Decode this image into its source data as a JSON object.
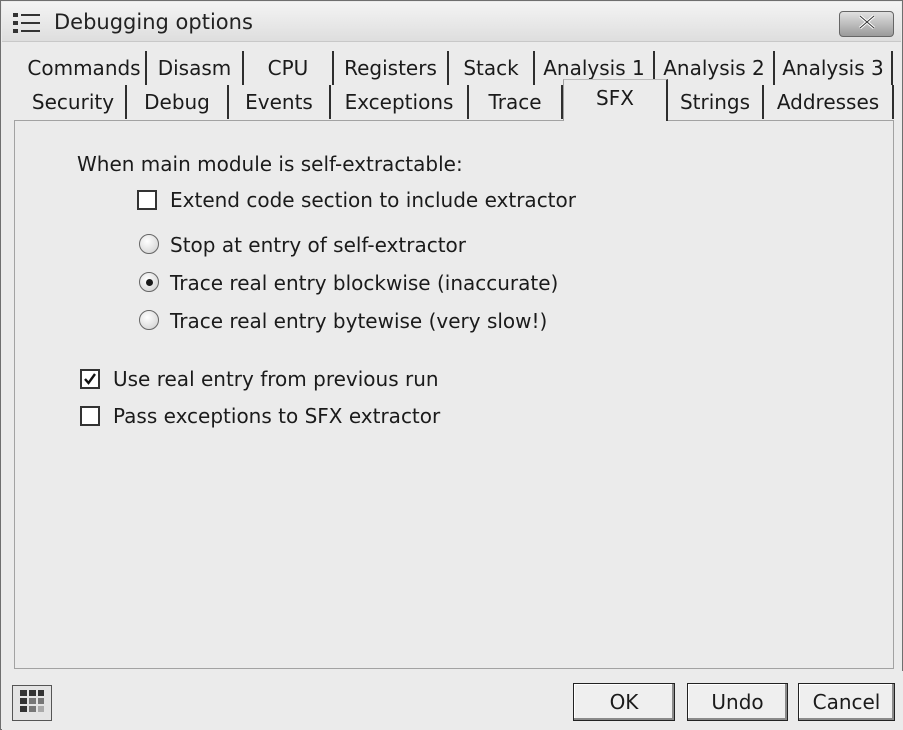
{
  "window": {
    "title": "Debugging options",
    "icons": {
      "app": "list-icon",
      "close": "close-icon"
    }
  },
  "tabs": {
    "row1": [
      "Commands",
      "Disasm",
      "CPU",
      "Registers",
      "Stack",
      "Analysis 1",
      "Analysis 2",
      "Analysis 3"
    ],
    "row2": [
      "Security",
      "Debug",
      "Events",
      "Exceptions",
      "Trace",
      "SFX",
      "Strings",
      "Addresses"
    ],
    "active": "SFX"
  },
  "sfx": {
    "heading": "When main module is self-extractable:",
    "extend_code": {
      "label": "Extend code section to include extractor",
      "checked": false
    },
    "radio_stop": {
      "label": "Stop at entry of self-extractor",
      "checked": false
    },
    "radio_blockwise": {
      "label": "Trace real entry blockwise (inaccurate)",
      "checked": true
    },
    "radio_bytewise": {
      "label": "Trace real entry bytewise (very slow!)",
      "checked": false
    },
    "use_real_entry": {
      "label": "Use real entry from previous run",
      "checked": true
    },
    "pass_exceptions": {
      "label": "Pass exceptions to SFX extractor",
      "checked": false
    }
  },
  "footer": {
    "layout_icon": "grid-icon",
    "ok": "OK",
    "undo": "Undo",
    "cancel": "Cancel"
  }
}
